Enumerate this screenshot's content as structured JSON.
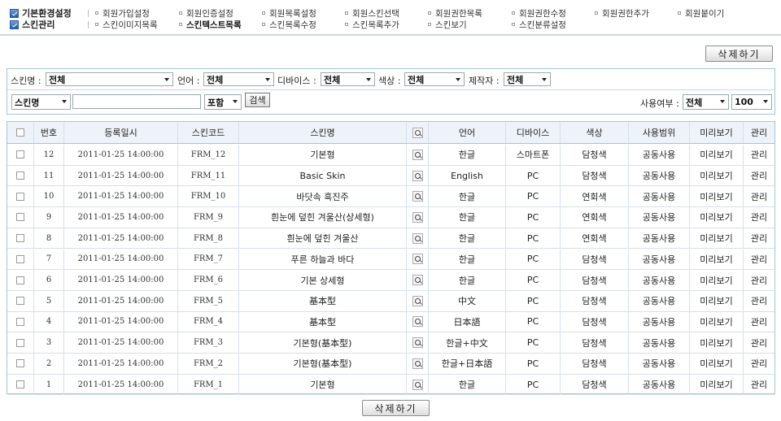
{
  "nav": {
    "categories": [
      {
        "label": "기본환경설정"
      },
      {
        "label": "스킨관리"
      }
    ],
    "row1": [
      "회원가입설정",
      "회원인증설정",
      "회원목록설정",
      "회원스킨선택",
      "회원권한목록",
      "회원권한수정",
      "회원권한추가",
      "회원붙이기"
    ],
    "row2": [
      "스킨이미지목록",
      "스킨텍스트목록",
      "스킨목록수정",
      "스킨목록추가",
      "스킨보기",
      "스킨분류설정"
    ],
    "active": "스킨텍스트목록"
  },
  "actions": {
    "delete_label": "삭제하기"
  },
  "filters": {
    "skin_name_label": "스킨명 :",
    "skin_name_value": "전체",
    "language_label": "언어 :",
    "language_value": "전체",
    "device_label": "디바이스 :",
    "device_value": "전체",
    "color_label": "색상 :",
    "color_value": "전체",
    "maker_label": "제작자 :",
    "maker_value": "전체",
    "search_field_value": "스킨명",
    "search_text_value": "",
    "match_value": "포함",
    "search_button": "검색",
    "usage_label": "사용여부 :",
    "usage_value": "전체",
    "page_size_value": "100"
  },
  "table": {
    "headers": [
      "번호",
      "등록일시",
      "스킨코드",
      "스킨명",
      "언어",
      "디바이스",
      "색상",
      "사용범위",
      "미리보기",
      "관리"
    ],
    "rows": [
      {
        "no": "12",
        "date": "2011-01-25 14:00:00",
        "code": "FRM_12",
        "name": "기본형",
        "lang": "한글",
        "device": "스마트폰",
        "color": "담청색",
        "scope": "공동사용",
        "preview": "미리보기",
        "manage": "관리"
      },
      {
        "no": "11",
        "date": "2011-01-25 14:00:00",
        "code": "FRM_11",
        "name": "Basic Skin",
        "lang": "English",
        "device": "PC",
        "color": "담청색",
        "scope": "공동사용",
        "preview": "미리보기",
        "manage": "관리"
      },
      {
        "no": "10",
        "date": "2011-01-25 14:00:00",
        "code": "FRM_10",
        "name": "바닷속 흑진주",
        "lang": "한글",
        "device": "PC",
        "color": "연회색",
        "scope": "공동사용",
        "preview": "미리보기",
        "manage": "관리"
      },
      {
        "no": "9",
        "date": "2011-01-25 14:00:00",
        "code": "FRM_9",
        "name": "흰눈에 덮힌 겨울산(상세형)",
        "lang": "한글",
        "device": "PC",
        "color": "연회색",
        "scope": "공동사용",
        "preview": "미리보기",
        "manage": "관리"
      },
      {
        "no": "8",
        "date": "2011-01-25 14:00:00",
        "code": "FRM_8",
        "name": "흰눈에 덮힌 겨울산",
        "lang": "한글",
        "device": "PC",
        "color": "연회색",
        "scope": "공동사용",
        "preview": "미리보기",
        "manage": "관리"
      },
      {
        "no": "7",
        "date": "2011-01-25 14:00:00",
        "code": "FRM_7",
        "name": "푸른 하늘과 바다",
        "lang": "한글",
        "device": "PC",
        "color": "담청색",
        "scope": "공동사용",
        "preview": "미리보기",
        "manage": "관리"
      },
      {
        "no": "6",
        "date": "2011-01-25 14:00:00",
        "code": "FRM_6",
        "name": "기본 상세형",
        "lang": "한글",
        "device": "PC",
        "color": "담청색",
        "scope": "공동사용",
        "preview": "미리보기",
        "manage": "관리"
      },
      {
        "no": "5",
        "date": "2011-01-25 14:00:00",
        "code": "FRM_5",
        "name": "基本型",
        "lang": "中文",
        "device": "PC",
        "color": "담청색",
        "scope": "공동사용",
        "preview": "미리보기",
        "manage": "관리"
      },
      {
        "no": "4",
        "date": "2011-01-25 14:00:00",
        "code": "FRM_4",
        "name": "基本型",
        "lang": "日本語",
        "device": "PC",
        "color": "담청색",
        "scope": "공동사용",
        "preview": "미리보기",
        "manage": "관리"
      },
      {
        "no": "3",
        "date": "2011-01-25 14:00:00",
        "code": "FRM_3",
        "name": "기본형(基本型)",
        "lang": "한글+中文",
        "device": "PC",
        "color": "담청색",
        "scope": "공동사용",
        "preview": "미리보기",
        "manage": "관리"
      },
      {
        "no": "2",
        "date": "2011-01-25 14:00:00",
        "code": "FRM_2",
        "name": "기본형(基本型)",
        "lang": "한글+日本語",
        "device": "PC",
        "color": "담청색",
        "scope": "공동사용",
        "preview": "미리보기",
        "manage": "관리"
      },
      {
        "no": "1",
        "date": "2011-01-25 14:00:00",
        "code": "FRM_1",
        "name": "기본형",
        "lang": "한글",
        "device": "PC",
        "color": "담청색",
        "scope": "공동사용",
        "preview": "미리보기",
        "manage": "관리"
      }
    ]
  },
  "icons": {
    "category": "checked-box-icon",
    "magnifier": "magnifier-icon",
    "bullet": "square-bullet-icon"
  },
  "colors": {
    "border": "#a9c1dd",
    "header_bg": "#eef3f9",
    "category_icon": "#2a5aa0"
  }
}
